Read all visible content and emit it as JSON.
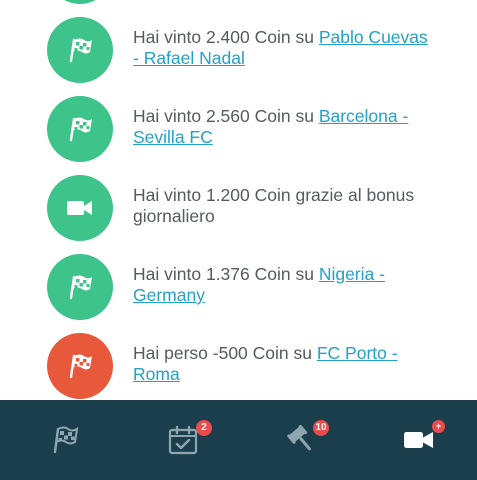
{
  "activity": [
    {
      "prefix": "Hai vinto 2.400 Coin su ",
      "link": "Pablo Cuevas - Rafael Nadal",
      "icon": "checkered-flag-icon",
      "status": "won"
    },
    {
      "prefix": "Hai vinto 2.560 Coin su ",
      "link": "Barcelona - Sevilla FC",
      "icon": "checkered-flag-icon",
      "status": "won"
    },
    {
      "prefix": "Hai vinto 1.200 Coin grazie al bonus giornaliero",
      "link": "",
      "icon": "video-camera-icon",
      "status": "won"
    },
    {
      "prefix": "Hai vinto 1.376 Coin su ",
      "link": "Nigeria - Germany",
      "icon": "checkered-flag-icon",
      "status": "won"
    },
    {
      "prefix": "Hai perso -500 Coin su ",
      "link": "FC Porto - Roma",
      "icon": "checkered-flag-icon",
      "status": "lost"
    }
  ],
  "nav": {
    "items": [
      {
        "name": "matches",
        "icon": "checkered-flag-icon",
        "badge": ""
      },
      {
        "name": "calendar",
        "icon": "calendar-check-icon",
        "badge": "2"
      },
      {
        "name": "auction",
        "icon": "gavel-icon",
        "badge": "10"
      },
      {
        "name": "videos",
        "icon": "video-camera-icon",
        "badge": "+"
      }
    ]
  },
  "colors": {
    "won": "#3ec48a",
    "lost": "#e8593c",
    "link": "#22a2c8",
    "navbar": "#1b3e4d",
    "badge": "#ec4b4b"
  }
}
